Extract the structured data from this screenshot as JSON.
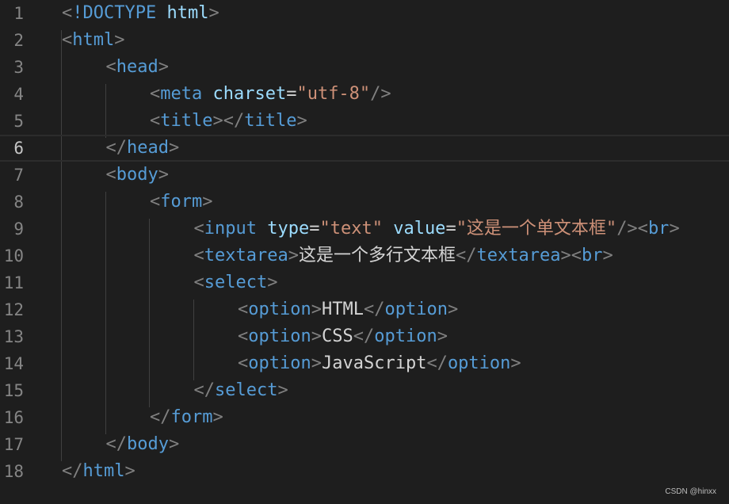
{
  "editor": {
    "active_line": 6,
    "lines": [
      {
        "n": "1",
        "indent": 0,
        "tokens": [
          [
            "p",
            "<"
          ],
          [
            "doc",
            "!DOCTYPE"
          ],
          [
            "x",
            " "
          ],
          [
            "a",
            "html"
          ],
          [
            "p",
            ">"
          ]
        ]
      },
      {
        "n": "2",
        "indent": 0,
        "tokens": [
          [
            "p",
            "<"
          ],
          [
            "t",
            "html"
          ],
          [
            "p",
            ">"
          ]
        ]
      },
      {
        "n": "3",
        "indent": 1,
        "tokens": [
          [
            "p",
            "<"
          ],
          [
            "t",
            "head"
          ],
          [
            "p",
            ">"
          ]
        ]
      },
      {
        "n": "4",
        "indent": 2,
        "tokens": [
          [
            "p",
            "<"
          ],
          [
            "t",
            "meta"
          ],
          [
            "x",
            " "
          ],
          [
            "a",
            "charset"
          ],
          [
            "x",
            "="
          ],
          [
            "s",
            "\"utf-8\""
          ],
          [
            "p",
            "/>"
          ]
        ]
      },
      {
        "n": "5",
        "indent": 2,
        "tokens": [
          [
            "p",
            "<"
          ],
          [
            "t",
            "title"
          ],
          [
            "p",
            "></"
          ],
          [
            "t",
            "title"
          ],
          [
            "p",
            ">"
          ]
        ]
      },
      {
        "n": "6",
        "indent": 1,
        "tokens": [
          [
            "p",
            "</"
          ],
          [
            "t",
            "head"
          ],
          [
            "p",
            ">"
          ]
        ]
      },
      {
        "n": "7",
        "indent": 1,
        "tokens": [
          [
            "p",
            "<"
          ],
          [
            "t",
            "body"
          ],
          [
            "p",
            ">"
          ]
        ]
      },
      {
        "n": "8",
        "indent": 2,
        "tokens": [
          [
            "p",
            "<"
          ],
          [
            "t",
            "form"
          ],
          [
            "p",
            ">"
          ]
        ]
      },
      {
        "n": "9",
        "indent": 3,
        "tokens": [
          [
            "p",
            "<"
          ],
          [
            "t",
            "input"
          ],
          [
            "x",
            " "
          ],
          [
            "a",
            "type"
          ],
          [
            "x",
            "="
          ],
          [
            "s",
            "\"text\""
          ],
          [
            "x",
            " "
          ],
          [
            "a",
            "value"
          ],
          [
            "x",
            "="
          ],
          [
            "s",
            "\"这是一个单文本框\""
          ],
          [
            "p",
            "/><"
          ],
          [
            "t",
            "br"
          ],
          [
            "p",
            ">"
          ]
        ]
      },
      {
        "n": "10",
        "indent": 3,
        "tokens": [
          [
            "p",
            "<"
          ],
          [
            "t",
            "textarea"
          ],
          [
            "p",
            ">"
          ],
          [
            "x",
            "这是一个多行文本框"
          ],
          [
            "p",
            "</"
          ],
          [
            "t",
            "textarea"
          ],
          [
            "p",
            "><"
          ],
          [
            "t",
            "br"
          ],
          [
            "p",
            ">"
          ]
        ]
      },
      {
        "n": "11",
        "indent": 3,
        "tokens": [
          [
            "p",
            "<"
          ],
          [
            "t",
            "select"
          ],
          [
            "p",
            ">"
          ]
        ]
      },
      {
        "n": "12",
        "indent": 4,
        "tokens": [
          [
            "p",
            "<"
          ],
          [
            "t",
            "option"
          ],
          [
            "p",
            ">"
          ],
          [
            "x",
            "HTML"
          ],
          [
            "p",
            "</"
          ],
          [
            "t",
            "option"
          ],
          [
            "p",
            ">"
          ]
        ]
      },
      {
        "n": "13",
        "indent": 4,
        "tokens": [
          [
            "p",
            "<"
          ],
          [
            "t",
            "option"
          ],
          [
            "p",
            ">"
          ],
          [
            "x",
            "CSS"
          ],
          [
            "p",
            "</"
          ],
          [
            "t",
            "option"
          ],
          [
            "p",
            ">"
          ]
        ]
      },
      {
        "n": "14",
        "indent": 4,
        "tokens": [
          [
            "p",
            "<"
          ],
          [
            "t",
            "option"
          ],
          [
            "p",
            ">"
          ],
          [
            "x",
            "JavaScript"
          ],
          [
            "p",
            "</"
          ],
          [
            "t",
            "option"
          ],
          [
            "p",
            ">"
          ]
        ]
      },
      {
        "n": "15",
        "indent": 3,
        "tokens": [
          [
            "p",
            "</"
          ],
          [
            "t",
            "select"
          ],
          [
            "p",
            ">"
          ]
        ]
      },
      {
        "n": "16",
        "indent": 2,
        "tokens": [
          [
            "p",
            "</"
          ],
          [
            "t",
            "form"
          ],
          [
            "p",
            ">"
          ]
        ]
      },
      {
        "n": "17",
        "indent": 1,
        "tokens": [
          [
            "p",
            "</"
          ],
          [
            "t",
            "body"
          ],
          [
            "p",
            ">"
          ]
        ]
      },
      {
        "n": "18",
        "indent": 0,
        "tokens": [
          [
            "p",
            "</"
          ],
          [
            "t",
            "html"
          ],
          [
            "p",
            ">"
          ]
        ]
      }
    ]
  },
  "colors": {
    "background": "#1e1e1e",
    "tag": "#569cd6",
    "attribute": "#9cdcfe",
    "string": "#ce9178",
    "punctuation": "#808080",
    "text": "#d4d4d4"
  },
  "watermark": "CSDN @hinxx"
}
